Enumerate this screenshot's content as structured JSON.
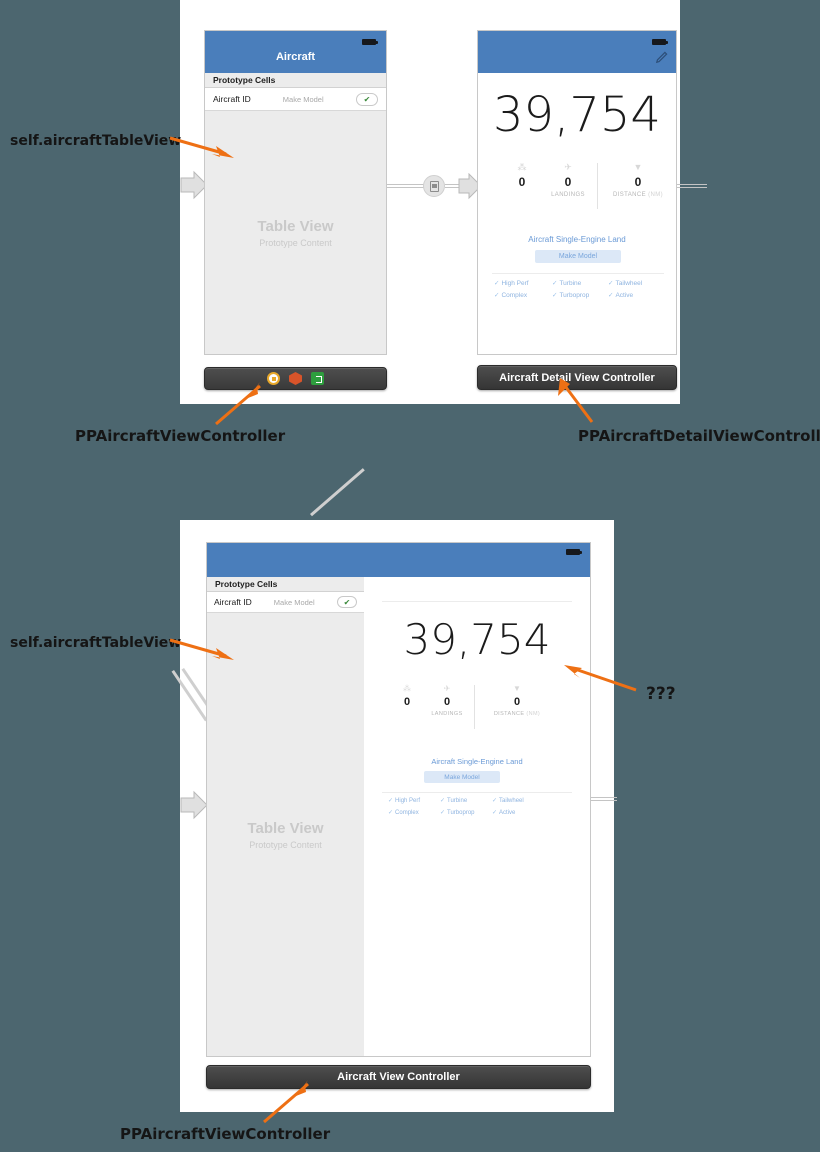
{
  "meta": {
    "background_color": "#4c666f",
    "canvas_color": "#ffffff",
    "accent_color": "#ee7014",
    "navbar_color": "#4a7ebb"
  },
  "annotations": [
    {
      "id": "anno-table-top",
      "text": "self.aircraftTableView"
    },
    {
      "id": "anno-vc-top",
      "text": "PPAircraftViewController"
    },
    {
      "id": "anno-detail-top",
      "text": "PPAircraftDetailViewController"
    },
    {
      "id": "anno-table-bot",
      "text": "self.aircraftTableView"
    },
    {
      "id": "anno-question",
      "text": "???"
    },
    {
      "id": "anno-vc-bot",
      "text": "PPAircraftViewController"
    }
  ],
  "scene_top_master": {
    "dock_label": "",
    "navbar_title": "Aircraft",
    "battery_icon": "battery-icon",
    "table": {
      "section_header": "Prototype Cells",
      "cell": {
        "title": "Aircraft ID",
        "detail": "Make Model",
        "accessory_icon": "checkmark-icon",
        "accessory_glyph": "✔"
      },
      "placeholder_title": "Table View",
      "placeholder_subtitle": "Prototype Content"
    },
    "dock_icons": [
      {
        "name": "view-controller-icon",
        "class": "ic-vc"
      },
      {
        "name": "first-responder-icon",
        "class": "ic-fr"
      },
      {
        "name": "exit-icon",
        "class": "ic-exit"
      }
    ]
  },
  "scene_top_detail": {
    "dock_label": "Aircraft Detail View Controller",
    "battery_icon": "battery-icon",
    "edit_icon": "pencil-icon",
    "hours": "39,754",
    "stats": [
      {
        "icon": "approaches-icon",
        "glyph": "⁂",
        "value": "0",
        "label": "",
        "unit": ""
      },
      {
        "icon": "landings-icon",
        "glyph": "✈",
        "value": "0",
        "label": "LANDINGS",
        "unit": ""
      },
      {
        "icon": "distance-icon",
        "glyph": "▼",
        "value": "0",
        "label": "DISTANCE",
        "unit": " (NM)"
      }
    ],
    "aircraft_type": "Aircraft Single-Engine Land",
    "make_model_badge": "Make Model",
    "flags": [
      {
        "label": "High Perf",
        "tick": "✓"
      },
      {
        "label": "Turbine",
        "tick": "✓"
      },
      {
        "label": "Tailwheel",
        "tick": "✓"
      },
      {
        "label": "Complex",
        "tick": "✓"
      },
      {
        "label": "Turboprop",
        "tick": "✓"
      },
      {
        "label": "Active",
        "tick": "✓"
      }
    ]
  },
  "scene_bottom": {
    "dock_label": "Aircraft View Controller",
    "navbar_title": "",
    "battery_icon": "battery-icon",
    "table": {
      "section_header": "Prototype Cells",
      "cell": {
        "title": "Aircraft ID",
        "detail": "Make Model",
        "accessory_icon": "checkmark-icon",
        "accessory_glyph": "✔"
      },
      "placeholder_title": "Table View",
      "placeholder_subtitle": "Prototype Content"
    },
    "detail": {
      "hours": "39,754",
      "stats": [
        {
          "icon": "approaches-icon",
          "glyph": "⁂",
          "value": "0",
          "label": "",
          "unit": ""
        },
        {
          "icon": "landings-icon",
          "glyph": "✈",
          "value": "0",
          "label": "LANDINGS",
          "unit": ""
        },
        {
          "icon": "distance-icon",
          "glyph": "▼",
          "value": "0",
          "label": "DISTANCE",
          "unit": " (NM)"
        }
      ],
      "aircraft_type": "Aircraft Single-Engine Land",
      "make_model_badge": "Make Model",
      "flags": [
        {
          "label": "High Perf",
          "tick": "✓"
        },
        {
          "label": "Turbine",
          "tick": "✓"
        },
        {
          "label": "Tailwheel",
          "tick": "✓"
        },
        {
          "label": "Complex",
          "tick": "✓"
        },
        {
          "label": "Turboprop",
          "tick": "✓"
        },
        {
          "label": "Active",
          "tick": "✓"
        }
      ]
    }
  }
}
